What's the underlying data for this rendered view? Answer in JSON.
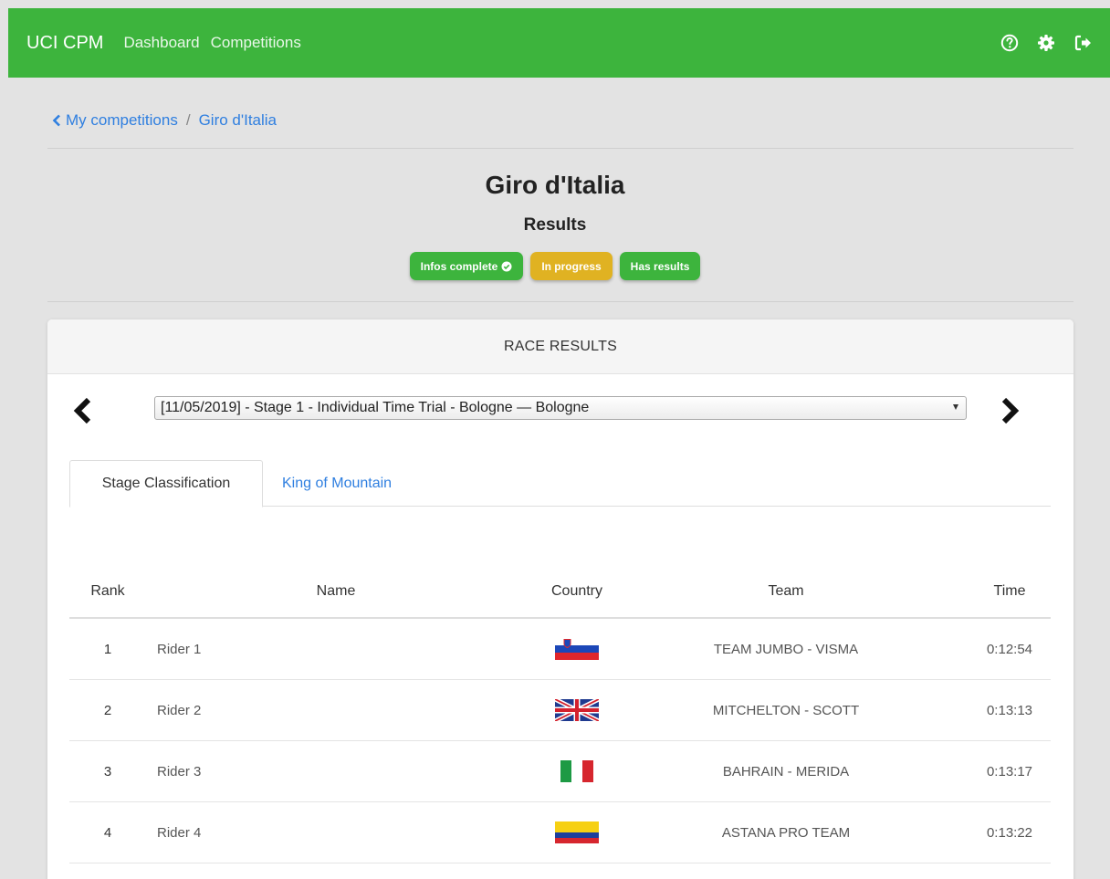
{
  "navbar": {
    "brand": "UCI CPM",
    "links": [
      "Dashboard",
      "Competitions"
    ],
    "icons": [
      "help-icon",
      "gear-icon",
      "logout-icon"
    ],
    "color": "#3db43d"
  },
  "breadcrumb": {
    "back_label": "My competitions",
    "separator": "/",
    "current": "Giro d'Italia"
  },
  "header": {
    "title": "Giro d'Italia",
    "subtitle": "Results"
  },
  "badges": [
    {
      "label": "Infos complete",
      "color": "#3db43d",
      "icon": "check-circle-icon"
    },
    {
      "label": "In progress",
      "color": "#e0b222"
    },
    {
      "label": "Has results",
      "color": "#3db43d"
    }
  ],
  "card": {
    "title": "RACE RESULTS",
    "stage_select": {
      "selected": "[11/05/2019] - Stage 1 - Individual Time Trial - Bologne — Bologne"
    },
    "tabs": [
      {
        "label": "Stage Classification",
        "active": true
      },
      {
        "label": "King of Mountain",
        "active": false
      }
    ],
    "table": {
      "columns": [
        "Rank",
        "Name",
        "Country",
        "Team",
        "Time"
      ],
      "rows": [
        {
          "rank": "1",
          "name": "Rider 1",
          "flag": "slovenia-flag",
          "team": "TEAM JUMBO - VISMA",
          "time": "0:12:54"
        },
        {
          "rank": "2",
          "name": "Rider 2",
          "flag": "uk-flag",
          "team": "MITCHELTON - SCOTT",
          "time": "0:13:13"
        },
        {
          "rank": "3",
          "name": "Rider 3",
          "flag": "italy-flag",
          "team": "BAHRAIN - MERIDA",
          "time": "0:13:17"
        },
        {
          "rank": "4",
          "name": "Rider 4",
          "flag": "colombia-flag",
          "team": "ASTANA PRO TEAM",
          "time": "0:13:22"
        }
      ]
    }
  }
}
